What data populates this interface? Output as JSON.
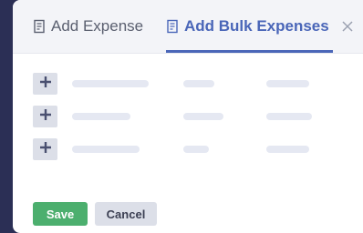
{
  "tabs": {
    "add_expense": "Add Expense",
    "add_bulk_expenses": "Add Bulk Expenses"
  },
  "icons": {
    "receipt": "receipt-icon",
    "close": "close-icon",
    "add": "plus-icon"
  },
  "buttons": {
    "save": "Save",
    "cancel": "Cancel"
  },
  "colors": {
    "accent": "#4a66b8",
    "save": "#4caf6e",
    "backdrop": "#2b2f55"
  }
}
